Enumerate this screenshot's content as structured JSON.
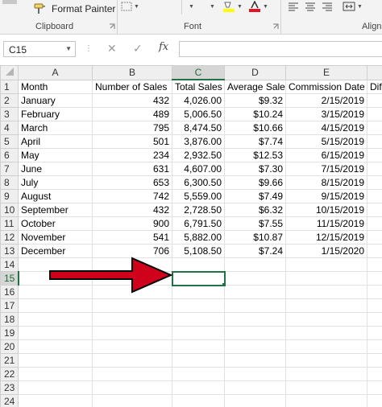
{
  "ribbon": {
    "format_painter_label": "Format Painter",
    "groups": {
      "clipboard": "Clipboard",
      "font": "Font",
      "alignment_partial": "Align"
    }
  },
  "formula_bar": {
    "name_box": "C15",
    "cancel_symbol": "✕",
    "enter_symbol": "✓",
    "fx_label": "fx",
    "formula": ""
  },
  "grid": {
    "columns": [
      "A",
      "B",
      "C",
      "D",
      "E"
    ],
    "row_numbers": [
      "1",
      "2",
      "3",
      "4",
      "5",
      "6",
      "7",
      "8",
      "9",
      "10",
      "11",
      "12",
      "13",
      "14",
      "15",
      "16",
      "17",
      "18",
      "19",
      "20",
      "21",
      "22",
      "23",
      "24"
    ],
    "headers": [
      "Month",
      "Number of Sales",
      "Total Sales",
      "Average Sale",
      "Commission Date",
      "Dif"
    ],
    "rows": [
      [
        "January",
        "432",
        "4,026.00",
        "$9.32",
        "2/15/2019"
      ],
      [
        "February",
        "489",
        "5,006.50",
        "$10.24",
        "3/15/2019"
      ],
      [
        "March",
        "795",
        "8,474.50",
        "$10.66",
        "4/15/2019"
      ],
      [
        "April",
        "501",
        "3,876.00",
        "$7.74",
        "5/15/2019"
      ],
      [
        "May",
        "234",
        "2,932.50",
        "$12.53",
        "6/15/2019"
      ],
      [
        "June",
        "631",
        "4,607.00",
        "$7.30",
        "7/15/2019"
      ],
      [
        "July",
        "653",
        "6,300.50",
        "$9.66",
        "8/15/2019"
      ],
      [
        "August",
        "742",
        "5,559.00",
        "$7.49",
        "9/15/2019"
      ],
      [
        "September",
        "432",
        "2,728.50",
        "$6.32",
        "10/15/2019"
      ],
      [
        "October",
        "900",
        "6,791.50",
        "$7.55",
        "11/15/2019"
      ],
      [
        "November",
        "541",
        "5,882.00",
        "$10.87",
        "12/15/2019"
      ],
      [
        "December",
        "706",
        "5,108.50",
        "$7.24",
        "1/15/2020"
      ]
    ],
    "selected_column": "C",
    "selected_row": "15"
  },
  "colors": {
    "accent_green": "#217346",
    "annotation_arrow": "#d0021b"
  }
}
